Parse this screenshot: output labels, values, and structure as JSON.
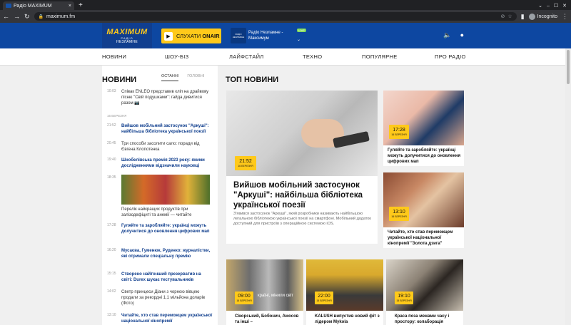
{
  "browser": {
    "tab_title": "Радіо MAXIMUM",
    "tab_close": "×",
    "new_tab": "+",
    "url": "maximum.fm",
    "profile": "Incognito"
  },
  "header": {
    "logo_main": "MAXIMUM",
    "logo_sub": "РАДІО",
    "logo_tag": "НЕЗЛАМНЕ",
    "listen_label": "СЛУХАТИ",
    "listen_bold": "ONAIR",
    "now_playing_line1": "Радіо Незламне -",
    "now_playing_line2": "Максимум",
    "cover_text": "РАДІО НЕЗЛАМНЕ",
    "live_badge": "LIVE"
  },
  "nav": [
    "НОВИНИ",
    "ШОУ-БІЗ",
    "ЛАЙФСТАЙЛ",
    "ТЕХНО",
    "ПОПУЛЯРНЕ",
    "ПРО РАДІО"
  ],
  "news_section": {
    "title": "НОВИНИ",
    "tab_latest": "ОСТАННІ",
    "tab_main": "ГОЛОВНІ",
    "date_divider": "16 БЕРЕЗНЯ",
    "items": [
      {
        "time": "10:03",
        "text": "Співак ENLEO представив кліп на драйвову пісню \"Свій подушками\": гайда дивитися разом 📷",
        "blue": false
      },
      {
        "time": "21:52",
        "text": "Вийшов мобільний застосунок \"Аркуші\": найбільша бібліотека української поезії",
        "blue": true
      },
      {
        "time": "20:45",
        "text": "Три способи засолити сало: поради від Євгена Клопотенка",
        "blue": false
      },
      {
        "time": "19:40",
        "text": "Шнобелівська премія 2023 року: якими дослідженнями відзначили науковці",
        "blue": true
      },
      {
        "time": "18:35",
        "text": "Перелік найкращих продуктів при залізодефіциті та анемії — читайте",
        "blue": false
      },
      {
        "time": "17:28",
        "text": "Гуляйте та заробляйте: українці можуть долучитися до оновлення цифрових мап",
        "blue": true
      },
      {
        "time": "16:20",
        "text": "Мусаєва, Гуменюк, Руденко: журналістки, які отримали спеціальну премію",
        "blue": true
      },
      {
        "time": "15:15",
        "text": "Створено найтонший презерватив на світі: Durex шукає тестувальників",
        "blue": true
      },
      {
        "time": "14:02",
        "text": "Светр принцеси Діани з чорною вівцею продали за рекордні 1,1 мільйона доларів (Фото)",
        "blue": false
      },
      {
        "time": "13:10",
        "text": "Читайте, хто став переможцем української національної кінопремії",
        "blue": true
      }
    ]
  },
  "top_news": {
    "title": "ТОП НОВИНИ",
    "main": {
      "time": "21:52",
      "date": "16 БЕРЕЗНЯ",
      "headline": "Вийшов мобільний застосунок \"Аркуші\": найбільша бібліотека української поезії",
      "summary": "З'явився застосунок \"Аркуші\", який розробники називають найбільшою легальною бібліотекою української поезії на смартфоні. Мобільний додаток доступний для пристроїв з операційною системою iOS."
    },
    "side": [
      {
        "time": "17:28",
        "date": "16 БЕРЕЗНЯ",
        "headline": "Гуляйте та заробляйте: українці можуть долучитися до оновлення цифрових мап"
      },
      {
        "time": "13:10",
        "date": "16 БЕРЕЗНЯ",
        "headline": "Читайте, хто став переможцем української національної кінопремії \"Золота дзига\""
      }
    ],
    "bottom": [
      {
        "time": "09:00",
        "date": "16 БЕРЕЗНЯ",
        "headline": "Сікорський, Бобонич, Амосов та інші –",
        "overlay": "країні, мінили світ"
      },
      {
        "time": "22:00",
        "date": "15 БЕРЕЗНЯ",
        "headline": "KALUSH випустив новий фіт з лідером Mykola"
      },
      {
        "time": "19:10",
        "date": "15 БЕРЕЗНЯ",
        "headline": "Краса поза межами часу і простору: колаборація"
      }
    ]
  }
}
